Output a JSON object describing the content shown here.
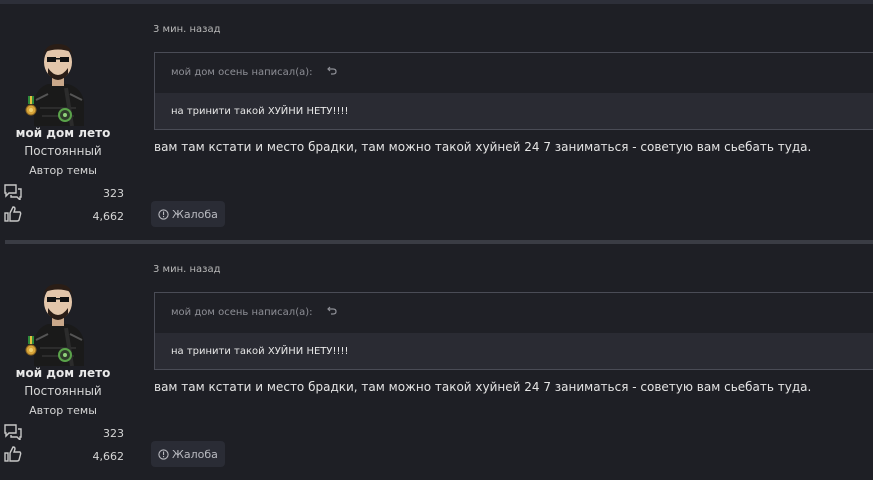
{
  "posts": [
    {
      "author": {
        "username": "мой дом лето",
        "rank": "Постоянный",
        "badge": "Автор темы",
        "messages": "323",
        "likes": "4,662"
      },
      "time": "3 мин. назад",
      "quote": {
        "header": "мой дом осень написал(а):",
        "text": "на тринити такой ХУЙНИ НЕТУ!!!!"
      },
      "message": "вам там кстати и место брадки, там можно такой хуйней 24 7 заниматься - советую вам сьебать туда.",
      "report_label": "Жалоба"
    },
    {
      "author": {
        "username": "мой дом лето",
        "rank": "Постоянный",
        "badge": "Автор темы",
        "messages": "323",
        "likes": "4,662"
      },
      "time": "3 мин. назад",
      "quote": {
        "header": "мой дом осень написал(а):",
        "text": "на тринити такой ХУЙНИ НЕТУ!!!!"
      },
      "message": "вам там кстати и место брадки, там можно такой хуйней 24 7 заниматься - советую вам сьебать туда.",
      "report_label": "Жалоба"
    }
  ],
  "icons": {
    "messages": "speech-bubbles-icon",
    "likes": "thumbs-up-icon",
    "quote_jump": "jump-back-arrow-icon",
    "report": "info-circle-icon"
  },
  "colors": {
    "background": "#1e1f25",
    "quote_body": "#2a2b33",
    "online": "#5aa34a"
  }
}
